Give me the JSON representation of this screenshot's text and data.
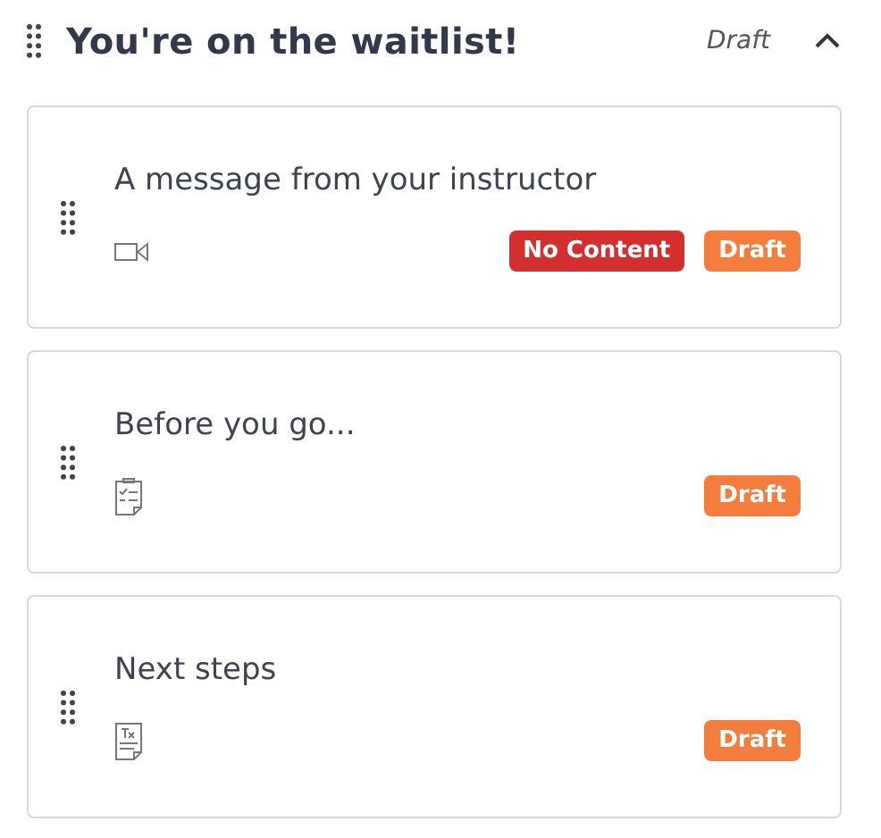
{
  "section": {
    "title": "You're on the waitlist!",
    "status": "Draft",
    "expanded": true
  },
  "lessons": [
    {
      "title": "A message from your instructor",
      "kind": "video",
      "badges": [
        {
          "label": "No Content",
          "kind": "error"
        },
        {
          "label": "Draft",
          "kind": "draft"
        }
      ]
    },
    {
      "title": "Before you go...",
      "kind": "survey",
      "badges": [
        {
          "label": "Draft",
          "kind": "draft"
        }
      ]
    },
    {
      "title": "Next steps",
      "kind": "text",
      "badges": [
        {
          "label": "Draft",
          "kind": "draft"
        }
      ]
    }
  ]
}
